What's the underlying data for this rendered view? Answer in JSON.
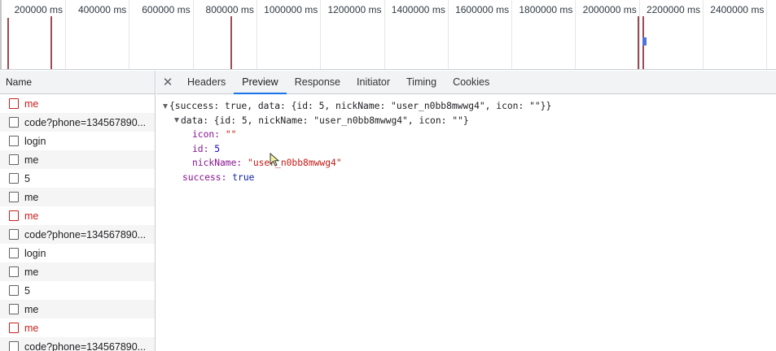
{
  "timeline": {
    "ticks": [
      "200000 ms",
      "400000 ms",
      "600000 ms",
      "800000 ms",
      "1000000 ms",
      "1200000 ms",
      "1400000 ms",
      "1600000 ms",
      "1800000 ms",
      "2000000 ms",
      "2200000 ms",
      "2400000 ms",
      "2"
    ]
  },
  "requests": {
    "header": "Name",
    "rows": [
      {
        "label": "me",
        "status": "error"
      },
      {
        "label": "code?phone=134567890...",
        "status": "ok"
      },
      {
        "label": "login",
        "status": "ok"
      },
      {
        "label": "me",
        "status": "ok"
      },
      {
        "label": "5",
        "status": "ok"
      },
      {
        "label": "me",
        "status": "ok"
      },
      {
        "label": "me",
        "status": "error"
      },
      {
        "label": "code?phone=134567890...",
        "status": "ok"
      },
      {
        "label": "login",
        "status": "ok"
      },
      {
        "label": "me",
        "status": "ok"
      },
      {
        "label": "5",
        "status": "ok"
      },
      {
        "label": "me",
        "status": "ok"
      },
      {
        "label": "me",
        "status": "error"
      },
      {
        "label": "code?phone=134567890...",
        "status": "ok"
      }
    ]
  },
  "detail": {
    "close": "✕",
    "tabs": [
      "Headers",
      "Preview",
      "Response",
      "Initiator",
      "Timing",
      "Cookies"
    ],
    "active_tab": "Preview",
    "preview": {
      "root_summary": "{success: true, data: {id: 5, nickName: \"user_n0bb8mwwg4\", icon: \"\"}}",
      "data_summary": "data: {id: 5, nickName: \"user_n0bb8mwwg4\", icon: \"\"}",
      "icon_key": "icon: ",
      "icon_value": "\"\"",
      "id_key": "id: ",
      "id_value": "5",
      "nick_key": "nickName: ",
      "nick_value": "\"user_n0bb8mwwg4\"",
      "success_key": "success: ",
      "success_value": "true"
    }
  },
  "colors": {
    "accent": "#1a73e8",
    "error": "#c5221f",
    "timeline_marker": "#9c4b55",
    "timeline_bar": "#4f73d8"
  }
}
